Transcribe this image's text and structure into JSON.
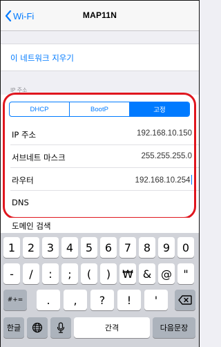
{
  "nav": {
    "back_label": "Wi-Fi",
    "title": "MAP11N"
  },
  "forget": {
    "label": "이 네트워크 지우기"
  },
  "ip_section": {
    "header": "IP 주소",
    "segments": [
      "DHCP",
      "BootP",
      "고정"
    ],
    "selected_segment": "고정",
    "rows": [
      {
        "label": "IP 주소",
        "value": "192.168.10.150"
      },
      {
        "label": "서브네트 마스크",
        "value": "255.255.255.0"
      },
      {
        "label": "라우터",
        "value": "192.168.10.254"
      },
      {
        "label": "DNS",
        "value": ""
      }
    ]
  },
  "domain": {
    "label": "도메인 검색"
  },
  "keyboard": {
    "row1": [
      "1",
      "2",
      "3",
      "4",
      "5",
      "6",
      "7",
      "8",
      "9",
      "0"
    ],
    "row2": [
      "-",
      "/",
      ":",
      ";",
      "(",
      ")",
      "₩",
      "&",
      "@",
      "\""
    ],
    "row3_shift": "#+=",
    "row3": [
      ".",
      ",",
      "?",
      "!",
      "'"
    ],
    "row4": {
      "lang": "한글",
      "space": "간격",
      "return": "다음문장"
    }
  },
  "colors": {
    "accent": "#007aff",
    "highlight": "#e0161e"
  }
}
